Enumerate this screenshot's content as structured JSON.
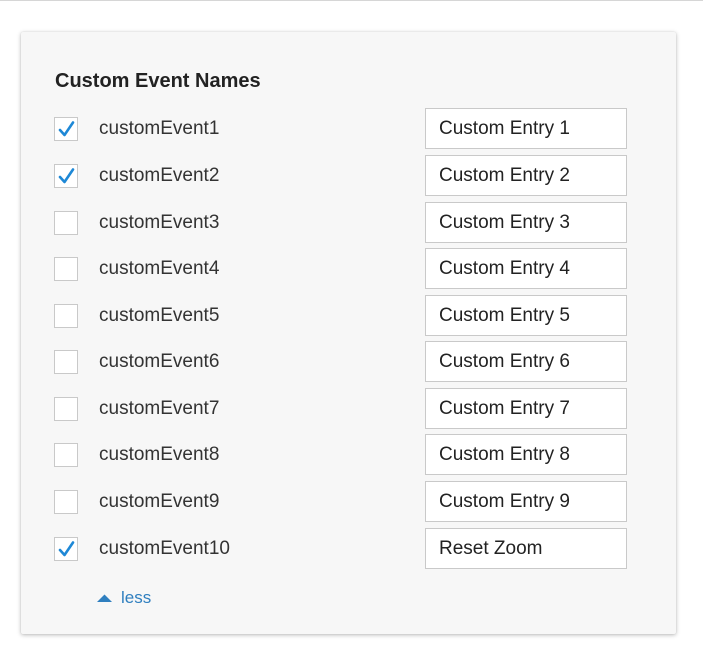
{
  "panel": {
    "title": "Custom Event Names",
    "rows": [
      {
        "label": "customEvent1",
        "checked": true,
        "value": "Custom Entry 1"
      },
      {
        "label": "customEvent2",
        "checked": true,
        "value": "Custom Entry 2"
      },
      {
        "label": "customEvent3",
        "checked": false,
        "value": "Custom Entry 3"
      },
      {
        "label": "customEvent4",
        "checked": false,
        "value": "Custom Entry 4"
      },
      {
        "label": "customEvent5",
        "checked": false,
        "value": "Custom Entry 5"
      },
      {
        "label": "customEvent6",
        "checked": false,
        "value": "Custom Entry 6"
      },
      {
        "label": "customEvent7",
        "checked": false,
        "value": "Custom Entry 7"
      },
      {
        "label": "customEvent8",
        "checked": false,
        "value": "Custom Entry 8"
      },
      {
        "label": "customEvent9",
        "checked": false,
        "value": "Custom Entry 9"
      },
      {
        "label": "customEvent10",
        "checked": true,
        "value": "Reset Zoom"
      }
    ],
    "toggle": {
      "label": "less",
      "icon": "caret-up-icon"
    }
  },
  "colors": {
    "panel_background": "#f7f7f7",
    "checkmark": "#1e88d6",
    "link": "#2f7fbf",
    "border": "#c9c9c9"
  }
}
